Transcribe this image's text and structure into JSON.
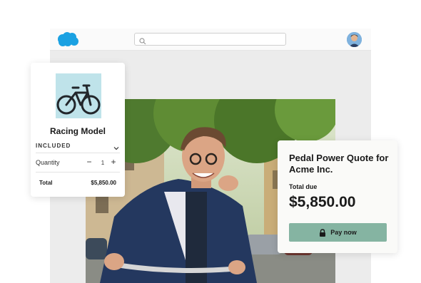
{
  "header": {
    "logo_icon": "salesforce-cloud-logo",
    "search": {
      "value": "",
      "placeholder": ""
    },
    "avatar_icon": "user-avatar"
  },
  "hero": {
    "image": "man-on-bicycle-photo"
  },
  "product_card": {
    "image": "bicycle-photo",
    "title": "Racing Model",
    "included_label": "INCLUDED",
    "quantity_label": "Quantity",
    "quantity_minus": "−",
    "quantity_value": "1",
    "quantity_plus": "+",
    "total_label": "Total",
    "total_value": "$5,850.00"
  },
  "quote_card": {
    "title": "Pedal Power Quote for Acme Inc.",
    "due_label": "Total due",
    "due_amount": "$5,850.00",
    "pay_label": "Pay now"
  },
  "colors": {
    "logo": "#1ba1e2",
    "pay_button": "#85b4a2",
    "frame": "#ececec"
  }
}
